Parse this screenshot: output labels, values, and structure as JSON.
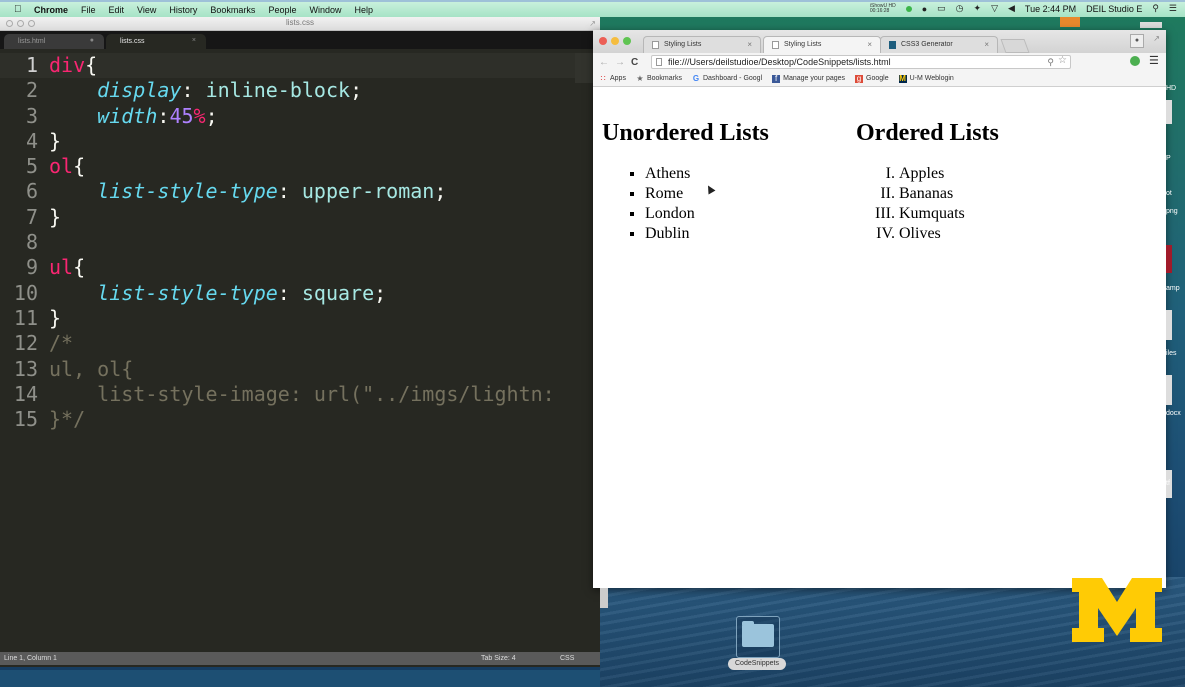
{
  "menubar": {
    "app_name": "Chrome",
    "items": [
      "File",
      "Edit",
      "View",
      "History",
      "Bookmarks",
      "People",
      "Window",
      "Help"
    ],
    "recording_label": "iShowU HD",
    "recording_time": "00:16:28",
    "clock": "Tue 2:44 PM",
    "user": "DEIL Studio E"
  },
  "editor": {
    "window_title": "lists.css",
    "tabs": [
      {
        "label": "lists.html",
        "active": false
      },
      {
        "label": "lists.css",
        "active": true
      }
    ],
    "lines": [
      {
        "num": "1",
        "tokens": [
          {
            "t": "div",
            "c": "sel"
          },
          {
            "t": "{",
            "c": "punc"
          }
        ]
      },
      {
        "num": "2",
        "tokens": [
          {
            "t": "    ",
            "c": "punc"
          },
          {
            "t": "display",
            "c": "prop"
          },
          {
            "t": ": ",
            "c": "punc"
          },
          {
            "t": "inline-block",
            "c": "val"
          },
          {
            "t": ";",
            "c": "punc"
          }
        ]
      },
      {
        "num": "3",
        "tokens": [
          {
            "t": "    ",
            "c": "punc"
          },
          {
            "t": "width",
            "c": "prop"
          },
          {
            "t": ":",
            "c": "punc"
          },
          {
            "t": "45",
            "c": "num"
          },
          {
            "t": "%",
            "c": "pct"
          },
          {
            "t": ";",
            "c": "punc"
          }
        ]
      },
      {
        "num": "4",
        "tokens": [
          {
            "t": "}",
            "c": "punc"
          }
        ]
      },
      {
        "num": "5",
        "tokens": [
          {
            "t": "ol",
            "c": "sel"
          },
          {
            "t": "{",
            "c": "punc"
          }
        ]
      },
      {
        "num": "6",
        "tokens": [
          {
            "t": "    ",
            "c": "punc"
          },
          {
            "t": "list-style-type",
            "c": "prop"
          },
          {
            "t": ": ",
            "c": "punc"
          },
          {
            "t": "upper-roman",
            "c": "val"
          },
          {
            "t": ";",
            "c": "punc"
          }
        ]
      },
      {
        "num": "7",
        "tokens": [
          {
            "t": "}",
            "c": "punc"
          }
        ]
      },
      {
        "num": "8",
        "tokens": []
      },
      {
        "num": "9",
        "tokens": [
          {
            "t": "ul",
            "c": "sel"
          },
          {
            "t": "{",
            "c": "punc"
          }
        ]
      },
      {
        "num": "10",
        "tokens": [
          {
            "t": "    ",
            "c": "punc"
          },
          {
            "t": "list-style-type",
            "c": "prop"
          },
          {
            "t": ": ",
            "c": "punc"
          },
          {
            "t": "square",
            "c": "val"
          },
          {
            "t": ";",
            "c": "punc"
          }
        ]
      },
      {
        "num": "11",
        "tokens": [
          {
            "t": "}",
            "c": "punc"
          }
        ]
      },
      {
        "num": "12",
        "tokens": [
          {
            "t": "/*",
            "c": "cmt"
          }
        ]
      },
      {
        "num": "13",
        "tokens": [
          {
            "t": "ul, ol{",
            "c": "cmt"
          }
        ]
      },
      {
        "num": "14",
        "tokens": [
          {
            "t": "    list-style-image: url(\"../imgs/lightn:",
            "c": "cmt"
          }
        ]
      },
      {
        "num": "15",
        "tokens": [
          {
            "t": "}*/",
            "c": "cmt"
          }
        ]
      }
    ],
    "status": {
      "position": "Line 1, Column 1",
      "tab_size": "Tab Size: 4",
      "syntax": "CSS"
    }
  },
  "browser": {
    "tabs": [
      {
        "label": "Styling Lists",
        "active": false,
        "icon": "page-icon"
      },
      {
        "label": "Styling Lists",
        "active": true,
        "icon": "page-icon"
      },
      {
        "label": "CSS3 Generator",
        "active": false,
        "icon": "css3-icon"
      }
    ],
    "url": "file:///Users/deilstudioe/Desktop/CodeSnippets/lists.html",
    "bookmarks": [
      {
        "label": "Apps",
        "icon": "apps-icon"
      },
      {
        "label": "Bookmarks",
        "icon": "star-icon"
      },
      {
        "label": "Dashboard - Googl",
        "icon": "google-g-icon"
      },
      {
        "label": "Manage your pages",
        "icon": "facebook-icon"
      },
      {
        "label": "Google",
        "icon": "google-plus-icon"
      },
      {
        "label": "U-M Weblogin",
        "icon": "um-icon"
      }
    ],
    "page": {
      "unordered": {
        "heading": "Unordered Lists",
        "items": [
          "Athens",
          "Rome",
          "London",
          "Dublin"
        ]
      },
      "ordered": {
        "heading": "Ordered Lists",
        "items": [
          "Apples",
          "Bananas",
          "Kumquats",
          "Olives"
        ]
      }
    }
  },
  "desktop": {
    "folder_label": "CodeSnippets",
    "side_labels": [
      "HD",
      "P",
      "ot",
      "png",
      "amp",
      "iles",
      "docx",
      "tf"
    ],
    "logo_color": "#FFCB05"
  }
}
